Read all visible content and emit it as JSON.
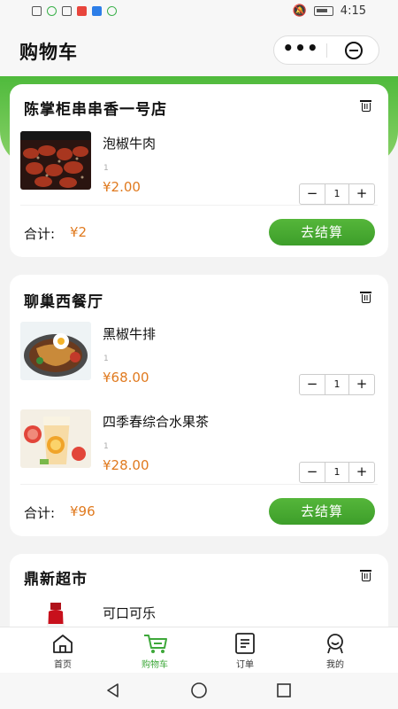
{
  "status_bar": {
    "time": "4:15"
  },
  "header": {
    "title": "购物车"
  },
  "capsule": {
    "more_label": "•••"
  },
  "stores": [
    {
      "name": "陈掌柜串串香一号店",
      "items": [
        {
          "name": "泡椒牛肉",
          "spec": "1",
          "price": "¥2.00",
          "quantity": "1"
        }
      ],
      "total_label": "合计:",
      "total_value": "¥2",
      "checkout_label": "去结算"
    },
    {
      "name": "聊巢西餐厅",
      "items": [
        {
          "name": "黑椒牛排",
          "spec": "1",
          "price": "¥68.00",
          "quantity": "1"
        },
        {
          "name": "四季春综合水果茶",
          "spec": "1",
          "price": "¥28.00",
          "quantity": "1"
        }
      ],
      "total_label": "合计:",
      "total_value": "¥96",
      "checkout_label": "去结算"
    },
    {
      "name": "鼎新超市",
      "items": [
        {
          "name": "可口可乐"
        }
      ]
    }
  ],
  "stepper": {
    "minus": "−",
    "plus": "+"
  },
  "tabbar": {
    "tabs": [
      {
        "label": "首页",
        "icon": "home-icon"
      },
      {
        "label": "购物车",
        "icon": "cart-icon",
        "active": true
      },
      {
        "label": "订单",
        "icon": "order-icon"
      },
      {
        "label": "我的",
        "icon": "profile-icon"
      }
    ]
  },
  "colors": {
    "accent": "#3ea83a",
    "price": "#e07a1f"
  }
}
